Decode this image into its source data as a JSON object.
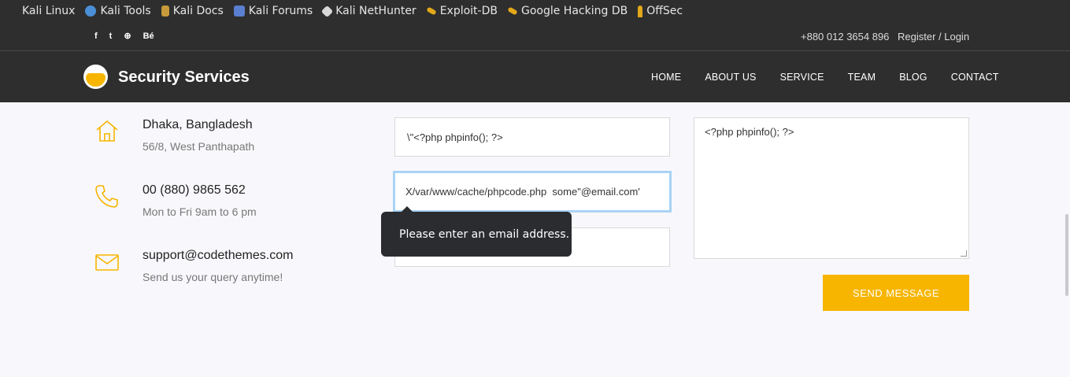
{
  "bookmarks": [
    {
      "label": "Kali Linux",
      "icon": "kali-linux-icon",
      "color": ""
    },
    {
      "label": "Kali Tools",
      "icon": "kali-tools-icon",
      "color": "#4a8fd6"
    },
    {
      "label": "Kali Docs",
      "icon": "kali-docs-icon",
      "color": "#c79a3a"
    },
    {
      "label": "Kali Forums",
      "icon": "kali-forums-icon",
      "color": "#5a7fd0"
    },
    {
      "label": "Kali NetHunter",
      "icon": "kali-nethunter-icon",
      "color": "#e0e0e0"
    },
    {
      "label": "Exploit-DB",
      "icon": "exploit-db-icon",
      "color": "#e2a81a"
    },
    {
      "label": "Google Hacking DB",
      "icon": "google-hacking-db-icon",
      "color": "#e2a81a"
    },
    {
      "label": "OffSec",
      "icon": "offsec-icon",
      "color": "#e2a81a"
    }
  ],
  "topbar": {
    "social": [
      "f",
      "t",
      "⊕",
      "Bé"
    ],
    "phone": "+880 012 3654 896",
    "register": "Register / Login"
  },
  "nav": {
    "brand": "Security Services",
    "menu": [
      "HOME",
      "ABOUT US",
      "SERVICE",
      "TEAM",
      "BLOG",
      "CONTACT"
    ]
  },
  "contact_info": [
    {
      "icon": "home-icon",
      "title": "Dhaka, Bangladesh",
      "subtitle": "56/8, West Panthapath"
    },
    {
      "icon": "phone-icon",
      "title": "00 (880) 9865 562",
      "subtitle": "Mon to Fri 9am to 6 pm"
    },
    {
      "icon": "mail-icon",
      "title": "support@codethemes.com",
      "subtitle": "Send us your query anytime!"
    }
  ],
  "form": {
    "name_value": "\\\"<?php phpinfo(); ?>",
    "email_value": "X/var/www/cache/phpcode.php  some\"@email.com'",
    "subject_value": "",
    "message_value": "<?php phpinfo(); ?>",
    "validation_message": "Please enter an email address.",
    "send_label": "SEND MESSAGE"
  },
  "colors": {
    "accent": "#f7b500",
    "dark_bg": "#2e2e2e",
    "focus_ring": "#a9d3f5"
  }
}
